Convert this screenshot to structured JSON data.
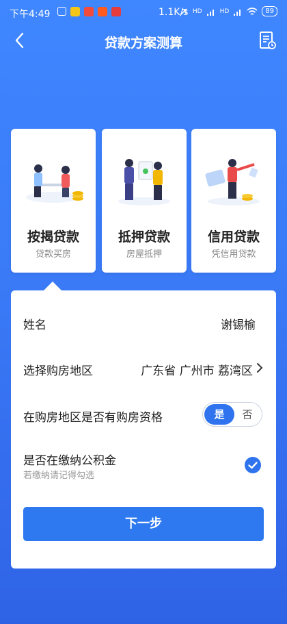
{
  "status_bar": {
    "time": "下午4:49",
    "net_speed": "1.1K/s",
    "signal1": "HD",
    "signal2": "HD",
    "battery": "89"
  },
  "header": {
    "title": "贷款方案测算"
  },
  "cards": [
    {
      "name": "按揭贷款",
      "sub": "贷款买房"
    },
    {
      "name": "抵押贷款",
      "sub": "房屋抵押"
    },
    {
      "name": "信用贷款",
      "sub": "凭信用贷款"
    }
  ],
  "form": {
    "name_label": "姓名",
    "name_value": "谢锡榆",
    "region_label": "选择购房地区",
    "region_value": "广东省 广州市 荔湾区",
    "qualify_label": "在购房地区是否有购房资格",
    "qualify_yes": "是",
    "qualify_no": "否",
    "fund_label": "是否在缴纳公积金",
    "fund_hint": "若缴纳请记得勾选",
    "next_button": "下一步"
  },
  "colors": {
    "accent": "#2f74ee",
    "background_top": "#3f87ff",
    "background_bottom": "#2f63e6"
  }
}
